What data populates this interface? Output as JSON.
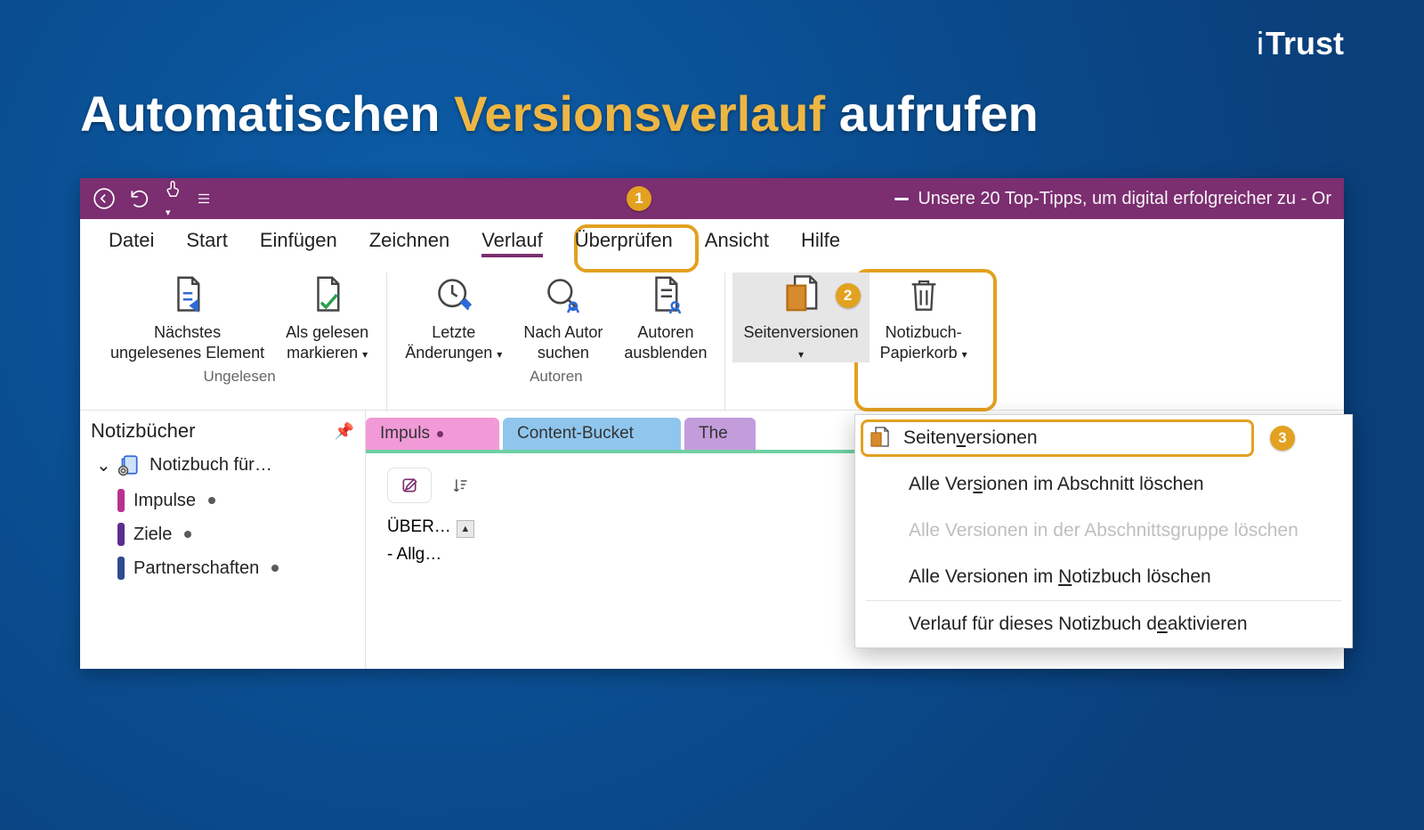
{
  "brand": "Trust",
  "title_a": "Automatischen ",
  "title_b": "Versionsverlauf",
  "title_c": " aufrufen",
  "callouts": {
    "one": "1",
    "two": "2",
    "three": "3"
  },
  "window_title": "Unsere 20 Top-Tipps, um digital erfolgreicher zu  -  Or",
  "menutabs": {
    "datei": "Datei",
    "start": "Start",
    "einfuegen": "Einfügen",
    "zeichnen": "Zeichnen",
    "verlauf": "Verlauf",
    "ueberpruefen": "Überprüfen",
    "ansicht": "Ansicht",
    "hilfe": "Hilfe"
  },
  "ribbon": {
    "unread": {
      "next1": "Nächstes",
      "next2": "ungelesenes Element",
      "mark1": "Als gelesen",
      "mark2": "markieren",
      "group": "Ungelesen"
    },
    "authors": {
      "recent1": "Letzte",
      "recent2": "Änderungen",
      "find1": "Nach Autor",
      "find2": "suchen",
      "hide1": "Autoren",
      "hide2": "ausblenden",
      "group": "Autoren"
    },
    "versions": {
      "page1": "Seitenversionen",
      "page2": "",
      "trash1": "Notizbuch-",
      "trash2": "Papierkorb"
    }
  },
  "sidebar": {
    "title": "Notizbücher",
    "notebook": "Notizbuch für…",
    "sections": [
      {
        "name": "Impulse",
        "color": "#b9318f"
      },
      {
        "name": "Ziele",
        "color": "#5a2e8f"
      },
      {
        "name": "Partnerschaften",
        "color": "#2e4b8f"
      }
    ]
  },
  "section_tabs": {
    "impuls": "Impuls",
    "content_bucket": "Content-Bucket",
    "the": "The"
  },
  "pages": {
    "p1": "ÜBER…",
    "p2": "- Allg…"
  },
  "dropdown": {
    "pageversions": "Seitenversionen",
    "del_section_a": "Alle Ver",
    "del_section_b": "s",
    "del_section_c": "ionen im Abschnitt löschen",
    "del_group": "Alle Versionen in der Abschnittsgruppe löschen",
    "del_nb_a": "Alle Versionen im ",
    "del_nb_b": "N",
    "del_nb_c": "otizbuch löschen",
    "disable_a": "Verlauf für dieses Notizbuch d",
    "disable_b": "e",
    "disable_c": "aktivieren"
  }
}
